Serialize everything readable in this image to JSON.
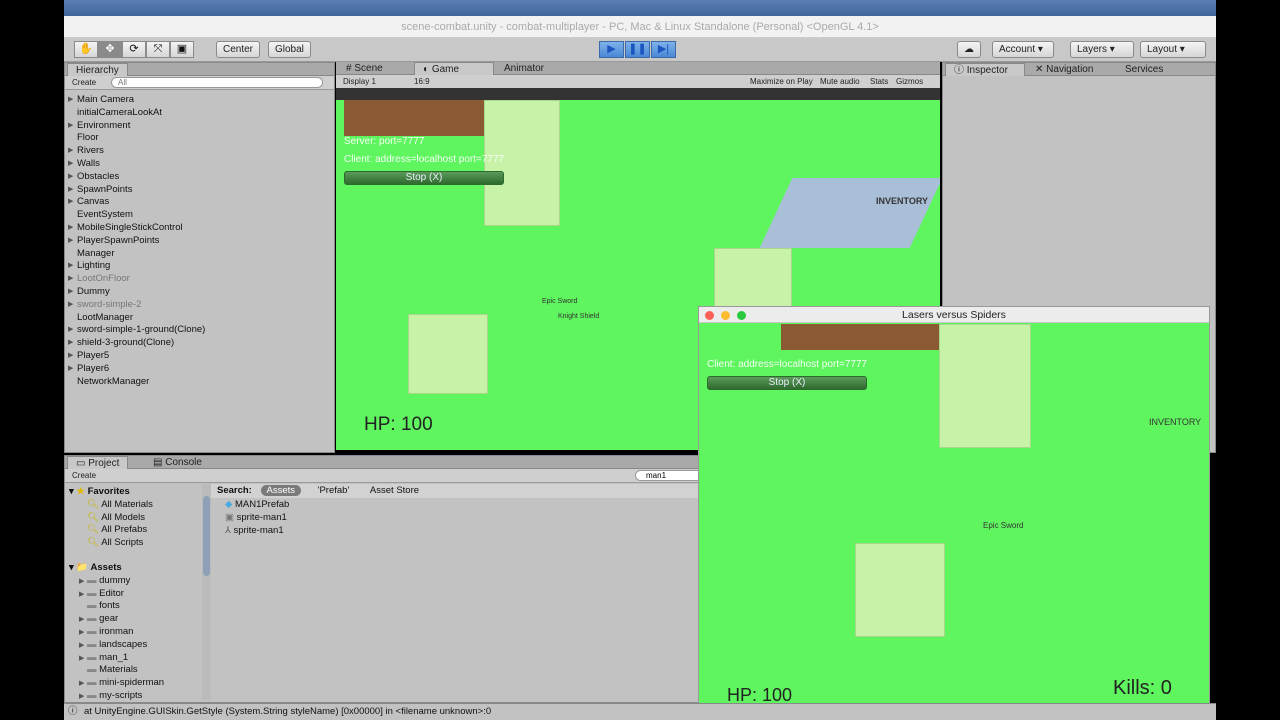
{
  "window": {
    "title": "scene-combat.unity - combat-multiplayer - PC, Mac & Linux Standalone (Personal) <OpenGL 4.1>"
  },
  "toolbar": {
    "tools": [
      "hand-icon",
      "move-icon",
      "rotate-icon",
      "scale-icon",
      "rect-icon"
    ],
    "pivot": "Center",
    "space": "Global",
    "play": "play-icon",
    "pause": "pause-icon",
    "step": "step-icon",
    "account": "Account",
    "layers": "Layers",
    "layout": "Layout"
  },
  "hierarchy": {
    "tab": "Hierarchy",
    "create": "Create",
    "search_placeholder": "All",
    "items": [
      {
        "label": "Main Camera",
        "arrow": true,
        "dim": false
      },
      {
        "label": "initialCameraLookAt",
        "arrow": false,
        "dim": false
      },
      {
        "label": "Environment",
        "arrow": true,
        "dim": false
      },
      {
        "label": "Floor",
        "arrow": false,
        "dim": false
      },
      {
        "label": "Rivers",
        "arrow": true,
        "dim": false
      },
      {
        "label": "Walls",
        "arrow": true,
        "dim": false
      },
      {
        "label": "Obstacles",
        "arrow": true,
        "dim": false
      },
      {
        "label": "SpawnPoints",
        "arrow": true,
        "dim": false
      },
      {
        "label": "Canvas",
        "arrow": true,
        "dim": false
      },
      {
        "label": "EventSystem",
        "arrow": false,
        "dim": false
      },
      {
        "label": "MobileSingleStickControl",
        "arrow": true,
        "dim": false
      },
      {
        "label": "PlayerSpawnPoints",
        "arrow": true,
        "dim": false
      },
      {
        "label": "Manager",
        "arrow": false,
        "dim": false
      },
      {
        "label": "Lighting",
        "arrow": true,
        "dim": false
      },
      {
        "label": "LootOnFloor",
        "arrow": true,
        "dim": true
      },
      {
        "label": "Dummy",
        "arrow": true,
        "dim": false
      },
      {
        "label": "sword-simple-2",
        "arrow": true,
        "dim": true
      },
      {
        "label": "LootManager",
        "arrow": false,
        "dim": false
      },
      {
        "label": "sword-simple-1-ground(Clone)",
        "arrow": true,
        "dim": false
      },
      {
        "label": "shield-3-ground(Clone)",
        "arrow": true,
        "dim": false
      },
      {
        "label": "Player5",
        "arrow": true,
        "dim": false
      },
      {
        "label": "Player6",
        "arrow": true,
        "dim": false
      },
      {
        "label": "NetworkManager",
        "arrow": false,
        "dim": false
      }
    ]
  },
  "center_tabs": {
    "scene": "Scene",
    "game": "Game",
    "animator": "Animator",
    "display": "Display 1",
    "aspect": "16:9",
    "maximize": "Maximize on Play",
    "mute": "Mute audio",
    "stats": "Stats",
    "gizmos": "Gizmos"
  },
  "game": {
    "server": "Server: port=7777",
    "client": "Client: address=localhost port=7777",
    "stop": "Stop (X)",
    "hp": "HP: 100",
    "inventory": "INVENTORY",
    "loot1": "Epic Sword",
    "loot2": "Knight Shield"
  },
  "inspector": {
    "tab": "Inspector",
    "navigation": "Navigation",
    "services": "Services"
  },
  "project": {
    "tab": "Project",
    "console": "Console",
    "create": "Create",
    "search_value": "man1",
    "search_label": "Search:",
    "scopes": [
      "Assets",
      "'Prefab'",
      "Asset Store"
    ],
    "favorites_label": "Favorites",
    "favorites": [
      "All Materials",
      "All Models",
      "All Prefabs",
      "All Scripts"
    ],
    "assets_label": "Assets",
    "folders": [
      {
        "label": "dummy",
        "arrow": true
      },
      {
        "label": "Editor",
        "arrow": true
      },
      {
        "label": "fonts",
        "arrow": false
      },
      {
        "label": "gear",
        "arrow": true
      },
      {
        "label": "ironman",
        "arrow": true
      },
      {
        "label": "landscapes",
        "arrow": true
      },
      {
        "label": "man_1",
        "arrow": true
      },
      {
        "label": "Materials",
        "arrow": false
      },
      {
        "label": "mini-spiderman",
        "arrow": true
      },
      {
        "label": "my-scripts",
        "arrow": true
      }
    ],
    "results": [
      {
        "label": "MAN1Prefab",
        "icon": "prefab-cube-icon"
      },
      {
        "label": "sprite-man1",
        "icon": "sprite-icon"
      },
      {
        "label": "sprite-man1",
        "icon": "avatar-icon"
      }
    ]
  },
  "float": {
    "title": "Lasers versus Spiders",
    "client": "Client: address=localhost port=7777",
    "stop": "Stop (X)",
    "hp": "HP: 100",
    "kills": "Kills: 0",
    "inventory": "INVENTORY",
    "loot": "Epic Sword"
  },
  "status": {
    "message": "at UnityEngine.GUISkin.GetStyle (System.String styleName) [0x00000] in <filename unknown>:0"
  },
  "colors": {
    "game_green": "#5ff55f",
    "play_blue": "#4a88d4"
  }
}
